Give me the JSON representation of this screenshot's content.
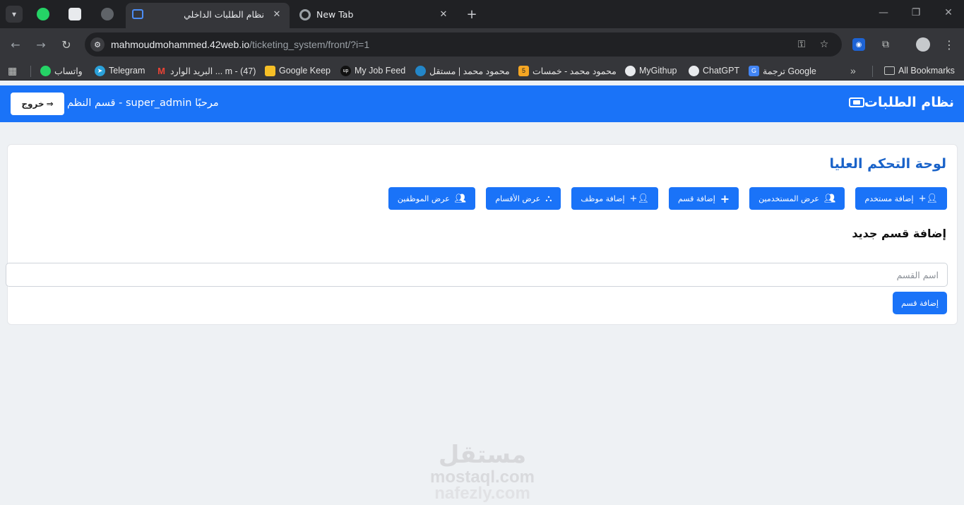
{
  "browser": {
    "tabs": [
      {
        "title": "نظام الطلبات الداخلي",
        "active": true
      },
      {
        "title": "New Tab",
        "active": false
      }
    ],
    "url_host": "mahmoudmohammed.42web.io",
    "url_path": "/ticketing_system/front/?i=1",
    "bookmarks": [
      {
        "label": "واتساب",
        "icon": "whatsapp-icon",
        "color": "#25d366"
      },
      {
        "label": "Telegram",
        "icon": "telegram-icon",
        "color": "#2aa1da"
      },
      {
        "label": "البريد الوارد ... m - (47)",
        "icon": "gmail-icon",
        "color": "#ea4335"
      },
      {
        "label": "Google Keep",
        "icon": "keep-icon",
        "color": "#f6bf26"
      },
      {
        "label": "My Job Feed",
        "icon": "upwork-icon",
        "color": "#111111"
      },
      {
        "label": "محمود محمد | مستقل",
        "icon": "mostaql-icon",
        "color": "#2386c8"
      },
      {
        "label": "محمود محمد - خمسات",
        "icon": "khamsat-icon",
        "color": "#f5a623"
      },
      {
        "label": "MyGithup",
        "icon": "github-icon",
        "color": "#ffffff"
      },
      {
        "label": "ChatGPT",
        "icon": "chatgpt-icon",
        "color": "#ffffff"
      },
      {
        "label": "ترجمة Google",
        "icon": "translate-icon",
        "color": "#4285f4"
      }
    ],
    "all_bookmarks": "All Bookmarks"
  },
  "navbar": {
    "brand": "نظام الطلبات",
    "welcome": "مرحبًا super_admin - قسم النظم",
    "logout": "خروج"
  },
  "card": {
    "title": "لوحة التحكم العليا",
    "buttons": [
      {
        "label": "إضافة مستخدم",
        "icon": "user-plus-icon"
      },
      {
        "label": "عرض المستخدمين",
        "icon": "users-icon"
      },
      {
        "label": "إضافة قسم",
        "icon": "plus-icon"
      },
      {
        "label": "إضافة موظف",
        "icon": "user-plus-icon"
      },
      {
        "label": "عرض الأقسام",
        "icon": "sitemap-icon"
      },
      {
        "label": "عرض الموظفين",
        "icon": "users-icon"
      }
    ],
    "section_title": "إضافة قسم جديد",
    "field_placeholder": "اسم القسم",
    "field_value": "",
    "submit": "إضافة قسم"
  },
  "watermark": {
    "logo": "مستقل",
    "line1": "mostaql.com",
    "line2": "nafezly.com"
  },
  "colors": {
    "primary": "#1a73f8",
    "title_blue": "#1a63c9",
    "page_bg": "#eef1f4"
  }
}
